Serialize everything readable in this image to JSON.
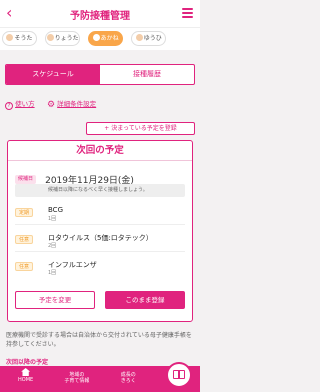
{
  "header": {
    "title": "予防接種管理",
    "back_icon": "‹",
    "accent": "#e0237e"
  },
  "kids": [
    {
      "name": "そうた",
      "active": false
    },
    {
      "name": "りょうた",
      "active": false
    },
    {
      "name": "あかね",
      "active": true
    },
    {
      "name": "ゆうひ",
      "active": false
    }
  ],
  "tabs": {
    "schedule": "スケジュール",
    "history": "接種履歴"
  },
  "links": {
    "help": "使い方",
    "help_icon": "?",
    "settings": "詳細条件設定",
    "settings_icon": "⚙"
  },
  "register_button": "+ 決まっている予定を登録",
  "card": {
    "title": "次回の予定",
    "date_badge": "候補日",
    "date": "2019年11月29日(金)",
    "note": "候補日以降になるべく早く接種しましょう。",
    "vaccines": [
      {
        "badge": "定期",
        "name": "BCG",
        "dose": "1回"
      },
      {
        "badge": "任意",
        "name": "ロタウイルス（5価:ロタテック）",
        "dose": "2回"
      },
      {
        "badge": "任意",
        "name": "インフルエンザ",
        "dose": "1回"
      }
    ],
    "change_button": "予定を変更",
    "confirm_button": "このまま登録"
  },
  "footer_note": "医療機関で受診する場合は自治体から交付されている母子健康手帳を持参してください。",
  "peek_text": "次回以降の予定",
  "nav": [
    {
      "label": "HOME"
    },
    {
      "label": "地域の\n子育て情報"
    },
    {
      "label": "成長の\nきろく"
    }
  ]
}
